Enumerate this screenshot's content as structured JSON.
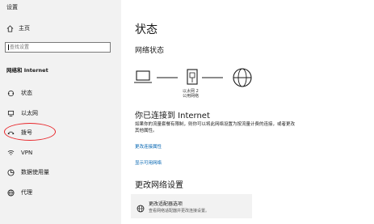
{
  "window": {
    "title": "设置"
  },
  "sidebar": {
    "home_label": "主页",
    "search_placeholder": "查找设置",
    "section_title": "网络和 Internet",
    "items": [
      {
        "label": "状态",
        "icon": "status-icon"
      },
      {
        "label": "以太网",
        "icon": "ethernet-icon"
      },
      {
        "label": "拨号",
        "icon": "dialup-icon"
      },
      {
        "label": "VPN",
        "icon": "vpn-icon"
      },
      {
        "label": "数据使用量",
        "icon": "data-usage-icon"
      },
      {
        "label": "代理",
        "icon": "proxy-icon"
      }
    ]
  },
  "main": {
    "title": "状态",
    "network_status_title": "网络状态",
    "adapter_name": "以太网 2",
    "network_type": "公用网络",
    "connected_title": "你已连接到 Internet",
    "connected_desc": "如果你的流量套餐有限制，则你可以将此网络设置为按流量计费的连接，或者更改其他属性。",
    "change_props_link": "更改连接属性",
    "show_networks_link": "显示可用网络",
    "change_settings_title": "更改网络设置",
    "adapter_options_title": "更改适配器选项",
    "adapter_options_desc": "查看网络适配器并更改连接设置。"
  },
  "colors": {
    "sidebar_bg": "#f2f2f2",
    "link": "#0063b1",
    "highlight_circle": "#e8262a"
  }
}
